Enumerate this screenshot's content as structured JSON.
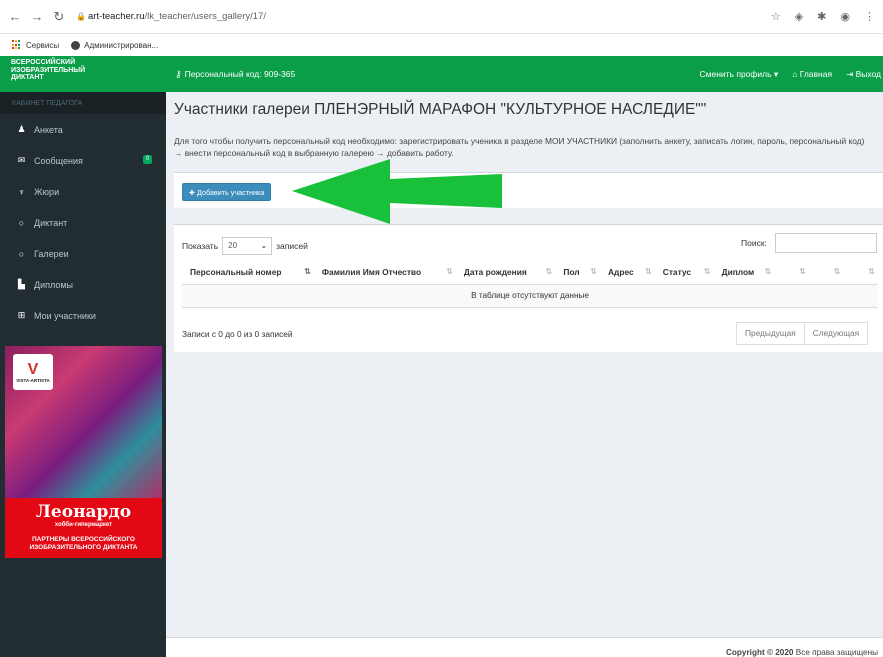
{
  "browser": {
    "url_domain": "art-teacher.ru",
    "url_path": "/lk_teacher/users_gallery/17/",
    "bookmarks": [
      {
        "label": "Сервисы"
      },
      {
        "label": "Администрирован..."
      }
    ]
  },
  "brand": {
    "line1": "Всероссийский",
    "line2": "изобразительный",
    "line3": "диктант"
  },
  "sidebar": {
    "section_title": "Кабинет педагога",
    "items": [
      {
        "label": "Анкета",
        "icon": "user-icon"
      },
      {
        "label": "Сообщения",
        "icon": "envelope-icon",
        "badge": "0"
      },
      {
        "label": "Жюри",
        "icon": "trophy-icon"
      },
      {
        "label": "Диктант",
        "icon": "circle-icon"
      },
      {
        "label": "Галереи",
        "icon": "circle-icon"
      },
      {
        "label": "Дипломы",
        "icon": "file-icon"
      },
      {
        "label": "Мои участники",
        "icon": "plus-square-icon"
      }
    ]
  },
  "ad": {
    "logo_text": "VISTA-ARTISTA",
    "brand": "Леонардо",
    "subtitle": "хобби-гипермаркет",
    "partners_line1": "ПАРТНЕРЫ ВСЕРОССИЙСКОГО",
    "partners_line2": "ИЗОБРАЗИТЕЛЬНОГО ДИКТАНТА"
  },
  "topbar": {
    "personal_code": "Персональный код: 909-365",
    "switch_profile": "Сменить профиль",
    "home": "Главная",
    "logout": "Выход"
  },
  "content": {
    "title": "Участники галереи ПЛЕНЭРНЫЙ МАРАФОН \"КУЛЬТУРНОЕ НАСЛЕДИЕ\"\"",
    "description": "Для того чтобы получить персональный код необходимо: зарегистрировать ученика в разделе МОИ УЧАСТНИКИ (заполнить анкету, записать логин, пароль, персональный код) → внести персональный код в выбранную галерею → добавить работу.",
    "add_button": "Добавить участника"
  },
  "table": {
    "show_label": "Показать",
    "show_value": "20",
    "entries_label": "записей",
    "search_label": "Поиск:",
    "columns": [
      "Персональный номер",
      "Фамилия Имя Отчество",
      "Дата рождения",
      "Пол",
      "Адрес",
      "Статус",
      "Диплом",
      "",
      "",
      ""
    ],
    "empty_text": "В таблице отсутствуют данные",
    "info": "Записи с 0 до 0 из 0 записей",
    "prev": "Предыдущая",
    "next": "Следующая"
  },
  "footer": {
    "copyright": "Copyright © 2020",
    "rights": "Все права защищены"
  },
  "colors": {
    "brand_green": "#0a9e49",
    "sidebar_dark": "#222d32",
    "button_blue": "#3c8dbc",
    "arrow_green": "#19c13a",
    "content_bg": "#ecf0f5"
  }
}
